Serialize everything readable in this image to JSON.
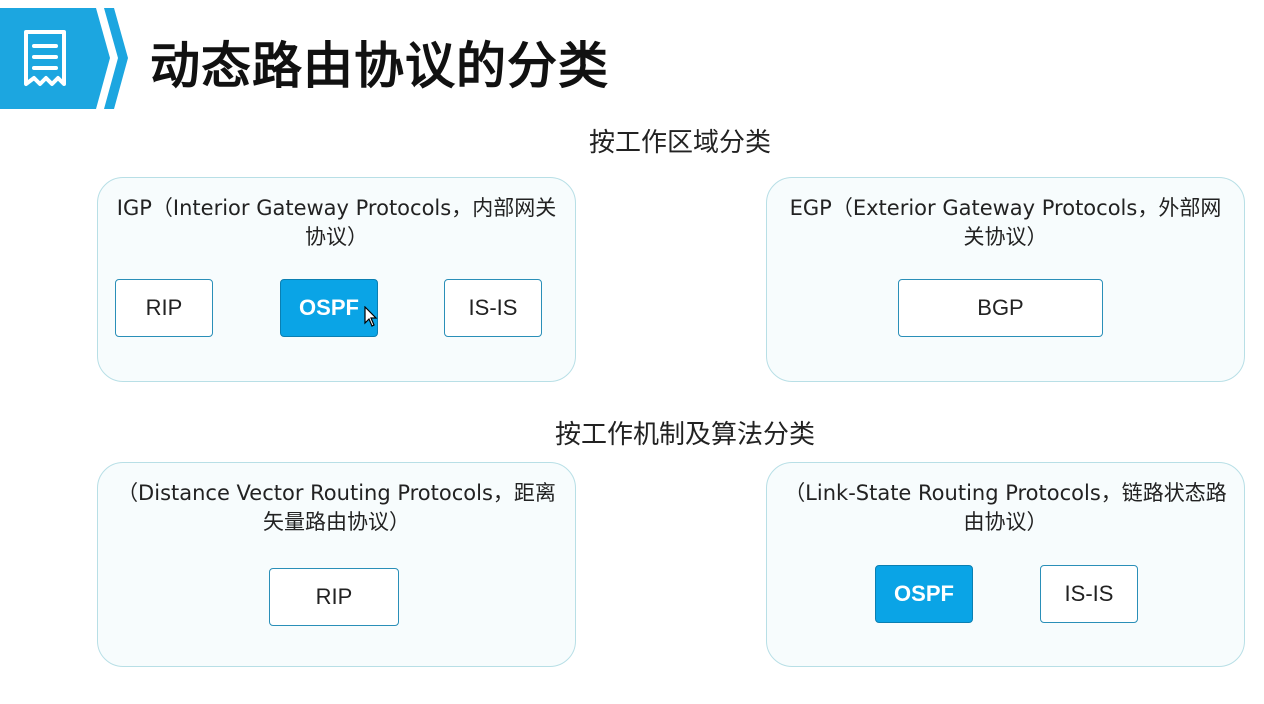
{
  "header": {
    "icon": "document-list-icon",
    "title": "动态路由协议的分类",
    "accent_color": "#1ca6e0"
  },
  "sections": [
    {
      "title": "按工作区域分类",
      "panels": [
        {
          "description_line1": "IGP（Interior Gateway Protocols，内部网关",
          "description_line2": "协议）",
          "protocols": [
            {
              "label": "RIP",
              "highlighted": false
            },
            {
              "label": "OSPF",
              "highlighted": true
            },
            {
              "label": "IS-IS",
              "highlighted": false
            }
          ]
        },
        {
          "description_line1": "EGP（Exterior Gateway Protocols，外部网",
          "description_line2": "关协议）",
          "protocols": [
            {
              "label": "BGP",
              "highlighted": false
            }
          ]
        }
      ]
    },
    {
      "title": "按工作机制及算法分类",
      "panels": [
        {
          "description_line1": "（Distance Vector Routing Protocols，距离",
          "description_line2": "矢量路由协议）",
          "protocols": [
            {
              "label": "RIP",
              "highlighted": false
            }
          ]
        },
        {
          "description_line1": "（Link-State Routing Protocols，链路状态路",
          "description_line2": "由协议）",
          "protocols": [
            {
              "label": "OSPF",
              "highlighted": true
            },
            {
              "label": "IS-IS",
              "highlighted": false
            }
          ]
        }
      ]
    }
  ],
  "colors": {
    "highlight_fill": "#0aa4e6",
    "button_border": "#2a8fb8",
    "panel_border": "#b8dfe6"
  }
}
